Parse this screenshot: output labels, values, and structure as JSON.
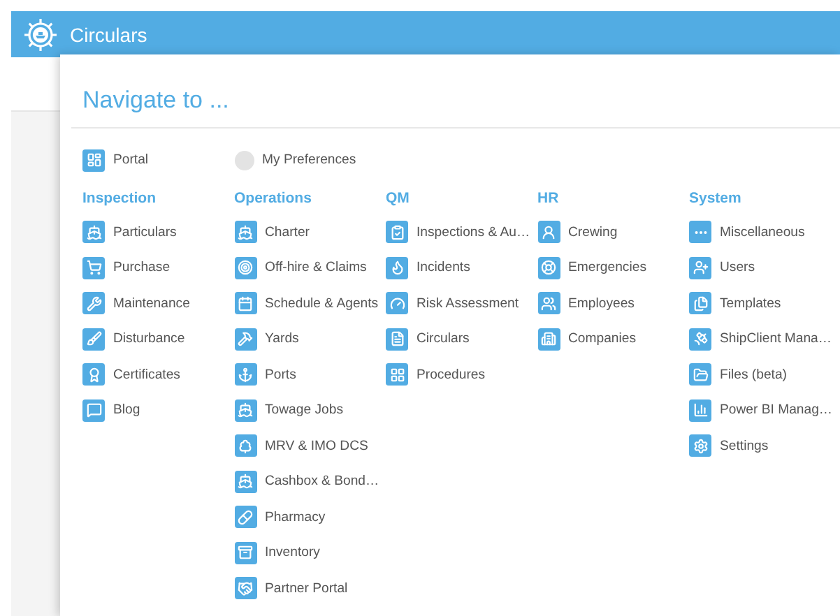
{
  "app_bar": {
    "title": "Circulars"
  },
  "menu": {
    "title": "Navigate to ...",
    "top_links": [
      {
        "label": "Portal"
      },
      {
        "label": "My Preferences"
      }
    ],
    "sections": [
      {
        "heading": "Inspection",
        "items": [
          "Particulars",
          "Purchase",
          "Maintenance",
          "Disturbance",
          "Certificates",
          "Blog"
        ]
      },
      {
        "heading": "Operations",
        "items": [
          "Charter",
          "Off-hire & Claims",
          "Schedule & Agents",
          "Yards",
          "Ports",
          "Towage Jobs",
          "MRV & IMO DCS",
          "Cashbox & Bond…",
          "Pharmacy",
          "Inventory",
          "Partner Portal"
        ]
      },
      {
        "heading": "QM",
        "items": [
          "Inspections & Au…",
          "Incidents",
          "Risk Assessment",
          "Circulars",
          "Procedures"
        ]
      },
      {
        "heading": "HR",
        "items": [
          "Crewing",
          "Emergencies",
          "Employees",
          "Companies"
        ]
      },
      {
        "heading": "System",
        "items": [
          "Miscellaneous",
          "Users",
          "Templates",
          "ShipClient Mana…",
          "Files (beta)",
          "Power BI Manag…",
          "Settings"
        ]
      }
    ]
  }
}
